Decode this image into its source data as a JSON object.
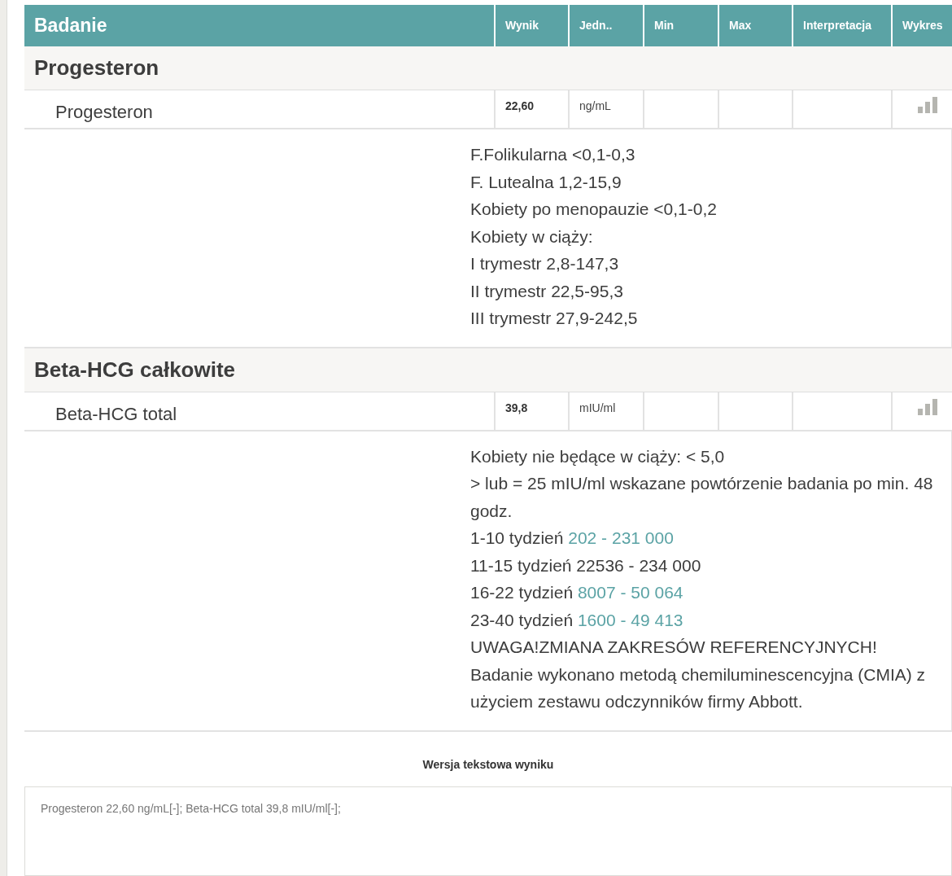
{
  "table": {
    "columns": [
      "Badanie",
      "Wynik",
      "Jedn..",
      "Min",
      "Max",
      "Interpretacja",
      "Wykres"
    ],
    "groups": [
      {
        "name": "Progesteron",
        "tests": [
          {
            "name": "Progesteron",
            "result": "22,60",
            "unit": "ng/mL"
          }
        ],
        "notes": [
          {
            "text": "F.Folikularna <0,1-0,3"
          },
          {
            "text": "F. Lutealna 1,2-15,9"
          },
          {
            "text": "Kobiety po menopauzie <0,1-0,2"
          },
          {
            "text": "Kobiety w ciąży:"
          },
          {
            "text": "I trymestr 2,8-147,3"
          },
          {
            "text": "II trymestr 22,5-95,3"
          },
          {
            "text": "III trymestr 27,9-242,5"
          }
        ]
      },
      {
        "name": "Beta-HCG całkowite",
        "tests": [
          {
            "name": "Beta-HCG total",
            "result": "39,8",
            "unit": "mIU/ml"
          }
        ],
        "notes": [
          {
            "text": "Kobiety nie będące w ciąży: < 5,0"
          },
          {
            "text": "> lub = 25 mIU/ml wskazane powtórzenie badania po min. 48 godz."
          },
          {
            "text": "1-10 tydzień ",
            "link": "202 - 231 000"
          },
          {
            "text": "11-15 tydzień 22536 - 234 000"
          },
          {
            "text": "16-22 tydzień ",
            "link": "8007 - 50 064"
          },
          {
            "text": "23-40 tydzień ",
            "link": "1600 - 49 413"
          },
          {
            "text": "UWAGA!ZMIANA ZAKRESÓW REFERENCYJNYCH!"
          },
          {
            "text": "Badanie wykonano metodą chemiluminescencyjna (CMIA) z użyciem zestawu odczynników firmy Abbott."
          }
        ]
      }
    ]
  },
  "text_version": {
    "title": "Wersja tekstowa wyniku",
    "value": "Progesteron 22,60 ng/mL[-]; Beta-HCG total 39,8 mIU/ml[-];"
  }
}
